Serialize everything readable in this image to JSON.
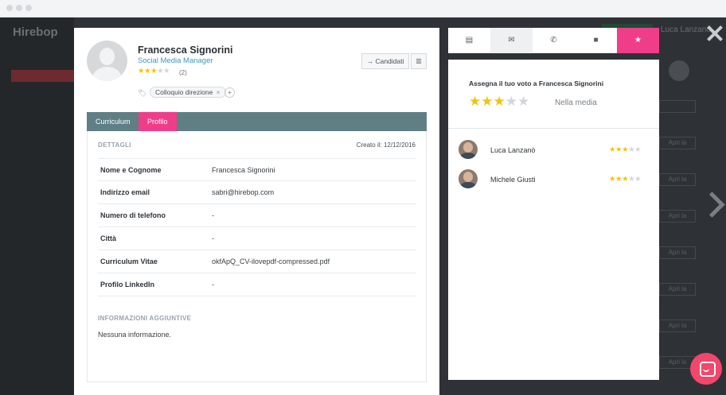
{
  "background": {
    "logo": "Hirebop",
    "user_name": "Luca Lanzanò",
    "row_button": "Apri la"
  },
  "candidate": {
    "name": "Francesca Signorini",
    "role": "Social Media Manager",
    "rating": 3,
    "rating_max": 5,
    "rating_count": "(2)",
    "tag": "Colloquio direzione",
    "tag_add": "+",
    "candidati_button": "Candidati",
    "delete_icon": "trash-icon"
  },
  "tabs": [
    {
      "label": "Curriculum",
      "active": false
    },
    {
      "label": "Profilo",
      "active": true
    }
  ],
  "details": {
    "section_title": "DETTAGLI",
    "created": "Creato il: 12/12/2016",
    "rows": [
      {
        "key": "Nome e Cognome",
        "value": "Francesca Signorini"
      },
      {
        "key": "Indirizzo email",
        "value": "sabri@hirebop.com"
      },
      {
        "key": "Numero di telefono",
        "value": "-"
      },
      {
        "key": "Città",
        "value": "-"
      },
      {
        "key": "Curriculum Vitae",
        "value": "okfApQ_CV-ilovepdf-compressed.pdf"
      },
      {
        "key": "Profilo LinkedIn",
        "value": "-"
      }
    ],
    "extra_title": "INFORMAZIONI AGGIUNTIVE",
    "extra_value": "Nessuna informazione."
  },
  "rating_panel": {
    "tabs": [
      {
        "icon": "document-icon",
        "glyph": "▤"
      },
      {
        "icon": "mail-icon",
        "glyph": "✉"
      },
      {
        "icon": "phone-icon",
        "glyph": "✆"
      },
      {
        "icon": "video-icon",
        "glyph": "■"
      },
      {
        "icon": "star-icon",
        "glyph": "★"
      }
    ],
    "assign_label": "Assegna il tuo voto a Francesca Signorini",
    "my_rating": 3,
    "average_label": "Nella media",
    "voters": [
      {
        "name": "Luca Lanzanò",
        "rating": 3
      },
      {
        "name": "Michele Giusti",
        "rating": 3
      }
    ]
  },
  "colors": {
    "accent": "#f03d8a",
    "tab_bar": "#5f7f85",
    "star": "#f1c40f",
    "link": "#3a98c4",
    "chat": "#f2476a"
  }
}
